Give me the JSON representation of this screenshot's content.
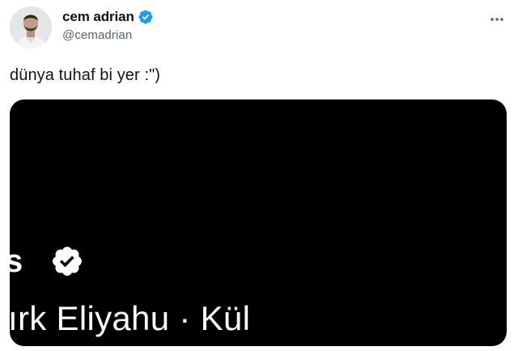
{
  "user": {
    "display_name": "cem adrian",
    "handle": "@cemadrian",
    "verified": true,
    "avatar": "profile-photo"
  },
  "tweet": {
    "text": "dünya tuhaf bi yer :\")"
  },
  "media": {
    "partial_name": "s",
    "caption": "ırk Eliyahu · Kül",
    "background": "#000000"
  },
  "icons": {
    "verified": "verified-badge-icon",
    "more": "more-options-icon"
  },
  "colors": {
    "accent": "#1d9bf0",
    "handle": "#536471",
    "text": "#0f1419"
  }
}
